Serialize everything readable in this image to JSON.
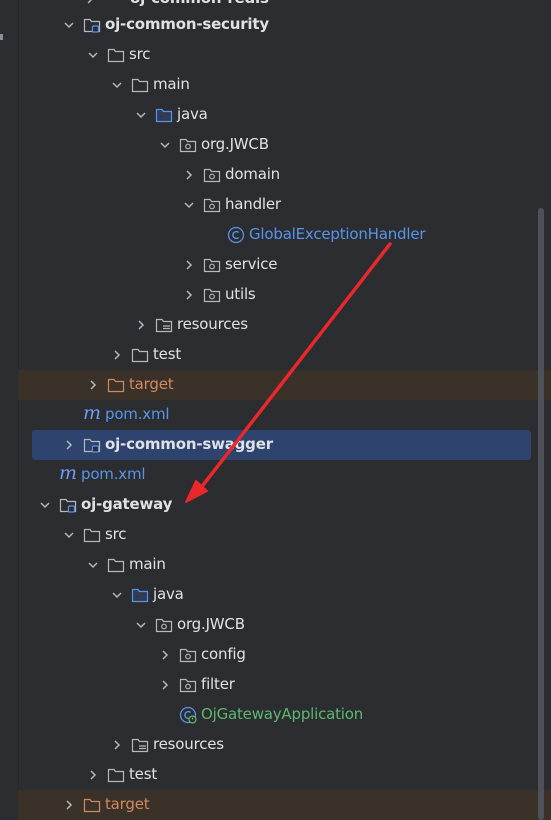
{
  "colors": {
    "background": "#2b2d30",
    "selection": "#2e436e",
    "target_row": "#3a3229",
    "arrow": "#e8282b",
    "text": "#dfe1e5",
    "blue_text": "#5895e8",
    "orange_text": "#d3875f",
    "green_text": "#5fb86f"
  },
  "tree": {
    "top_partial": "oj-common-redis",
    "items": [
      {
        "label": "oj-common-security",
        "icon": "module-folder-icon",
        "chevron": "down",
        "style": "bold"
      },
      {
        "label": "src",
        "icon": "folder-icon",
        "chevron": "down",
        "style": "normal"
      },
      {
        "label": "main",
        "icon": "folder-icon",
        "chevron": "down",
        "style": "normal"
      },
      {
        "label": "java",
        "icon": "source-folder-icon",
        "chevron": "down",
        "style": "normal"
      },
      {
        "label": "org.JWCB",
        "icon": "package-icon",
        "chevron": "down",
        "style": "normal"
      },
      {
        "label": "domain",
        "icon": "package-icon",
        "chevron": "right",
        "style": "normal"
      },
      {
        "label": "handler",
        "icon": "package-icon",
        "chevron": "down",
        "style": "normal"
      },
      {
        "label": "GlobalExceptionHandler",
        "icon": "class-icon",
        "chevron": "none",
        "style": "blue"
      },
      {
        "label": "service",
        "icon": "package-icon",
        "chevron": "right",
        "style": "normal"
      },
      {
        "label": "utils",
        "icon": "package-icon",
        "chevron": "right",
        "style": "normal"
      },
      {
        "label": "resources",
        "icon": "resources-folder-icon",
        "chevron": "right",
        "style": "normal"
      },
      {
        "label": "test",
        "icon": "folder-icon",
        "chevron": "right",
        "style": "normal"
      },
      {
        "label": "target",
        "icon": "excluded-folder-icon",
        "chevron": "right",
        "style": "orange"
      },
      {
        "label": "pom.xml",
        "icon": "maven-icon",
        "chevron": "none",
        "style": "blue"
      },
      {
        "label": "oj-common-swagger",
        "icon": "module-folder-icon",
        "chevron": "right",
        "style": "bold"
      },
      {
        "label": "pom.xml",
        "icon": "maven-icon",
        "chevron": "none",
        "style": "blue"
      },
      {
        "label": "oj-gateway",
        "icon": "module-folder-icon",
        "chevron": "down",
        "style": "bold"
      },
      {
        "label": "src",
        "icon": "folder-icon",
        "chevron": "down",
        "style": "normal"
      },
      {
        "label": "main",
        "icon": "folder-icon",
        "chevron": "down",
        "style": "normal"
      },
      {
        "label": "java",
        "icon": "source-folder-icon",
        "chevron": "down",
        "style": "normal"
      },
      {
        "label": "org.JWCB",
        "icon": "package-icon",
        "chevron": "down",
        "style": "normal"
      },
      {
        "label": "config",
        "icon": "package-icon",
        "chevron": "right",
        "style": "normal"
      },
      {
        "label": "filter",
        "icon": "package-icon",
        "chevron": "right",
        "style": "normal"
      },
      {
        "label": "OjGatewayApplication",
        "icon": "spring-boot-class-icon",
        "chevron": "none",
        "style": "green"
      },
      {
        "label": "resources",
        "icon": "resources-folder-icon",
        "chevron": "right",
        "style": "normal"
      },
      {
        "label": "test",
        "icon": "folder-icon",
        "chevron": "right",
        "style": "normal"
      },
      {
        "label": "target",
        "icon": "excluded-folder-icon",
        "chevron": "right",
        "style": "orange"
      }
    ]
  },
  "annotation": {
    "type": "red-arrow",
    "from_item": "GlobalExceptionHandler",
    "to_item": "oj-gateway"
  }
}
